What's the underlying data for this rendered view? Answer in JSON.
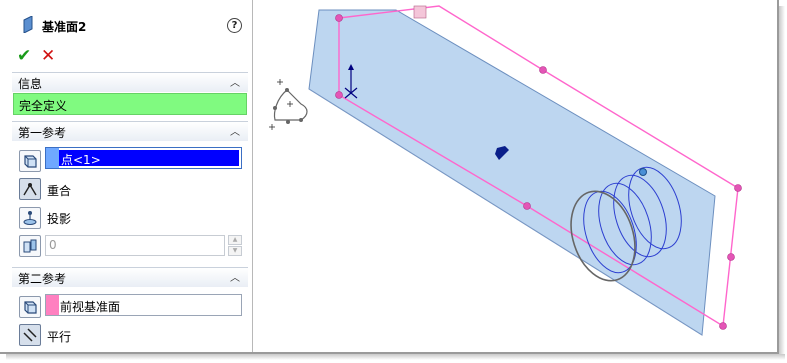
{
  "panel": {
    "title": "基准面2",
    "help_icon": "?",
    "info_group": {
      "label": "信息",
      "status": "完全定义"
    },
    "first_reference": {
      "label": "第一参考",
      "value": "点<1>",
      "options": [
        {
          "label": "重合",
          "icon": "coincident-icon"
        },
        {
          "label": "投影",
          "icon": "projection-icon"
        }
      ],
      "distance_value": "0"
    },
    "second_reference": {
      "label": "第二参考",
      "value": "前视基准面",
      "options": [
        {
          "label": "平行",
          "icon": "parallel-icon"
        }
      ]
    }
  },
  "colors": {
    "status_green": "#80fa80",
    "first_ref_swatch": "#6fa8ff",
    "second_ref_swatch": "#ff80c0",
    "plane_fill": "#b6d2ee",
    "preview_plane": "#ff66cc",
    "selection_blue": "#0000ff"
  }
}
